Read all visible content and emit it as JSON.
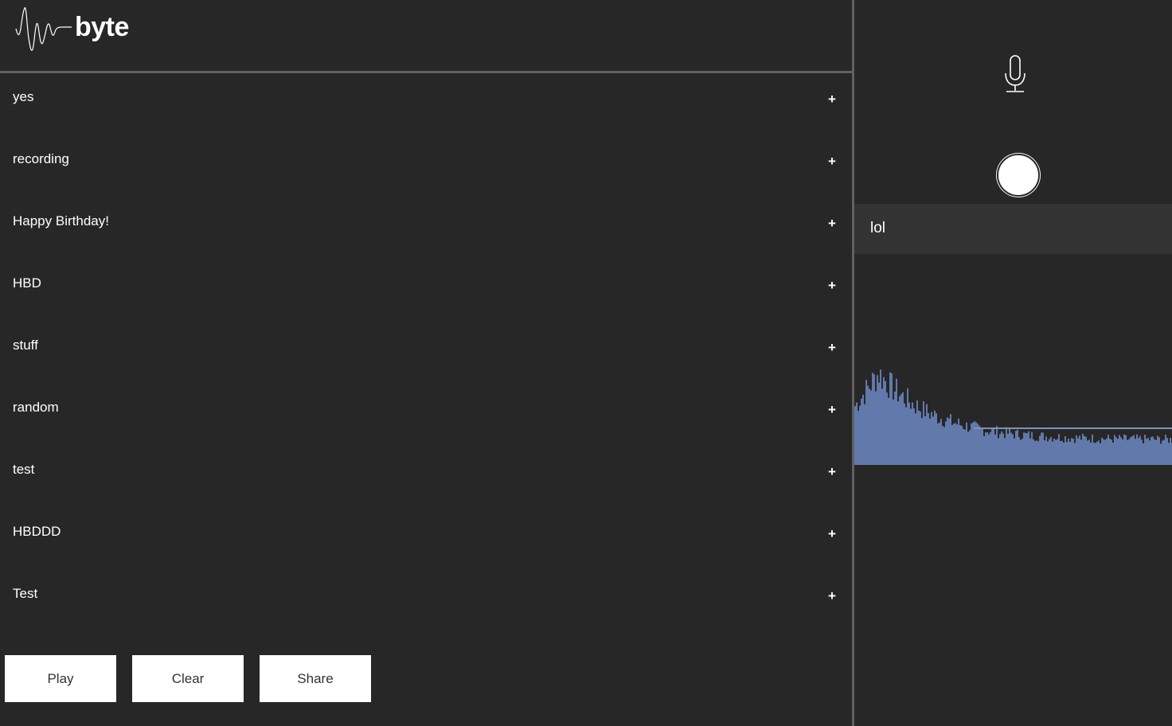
{
  "brand": {
    "name": "byte",
    "logo_icon": "soundwave-icon"
  },
  "recordings": [
    {
      "label": "yes",
      "action": "+"
    },
    {
      "label": "recording",
      "action": "+"
    },
    {
      "label": "Happy Birthday!",
      "action": "+"
    },
    {
      "label": "HBD",
      "action": "+"
    },
    {
      "label": "stuff",
      "action": "+"
    },
    {
      "label": "random",
      "action": "+"
    },
    {
      "label": "test",
      "action": "+"
    },
    {
      "label": "HBDDD",
      "action": "+"
    },
    {
      "label": "Test",
      "action": "+"
    }
  ],
  "controls": {
    "play_label": "Play",
    "clear_label": "Clear",
    "share_label": "Share"
  },
  "recorder": {
    "mic_icon": "microphone-icon",
    "record_icon": "record-circle-icon",
    "current_name": "lol"
  },
  "colors": {
    "background": "#272727",
    "divider": "#616161",
    "name_bar": "#333333",
    "waveform": "#6279ab"
  }
}
